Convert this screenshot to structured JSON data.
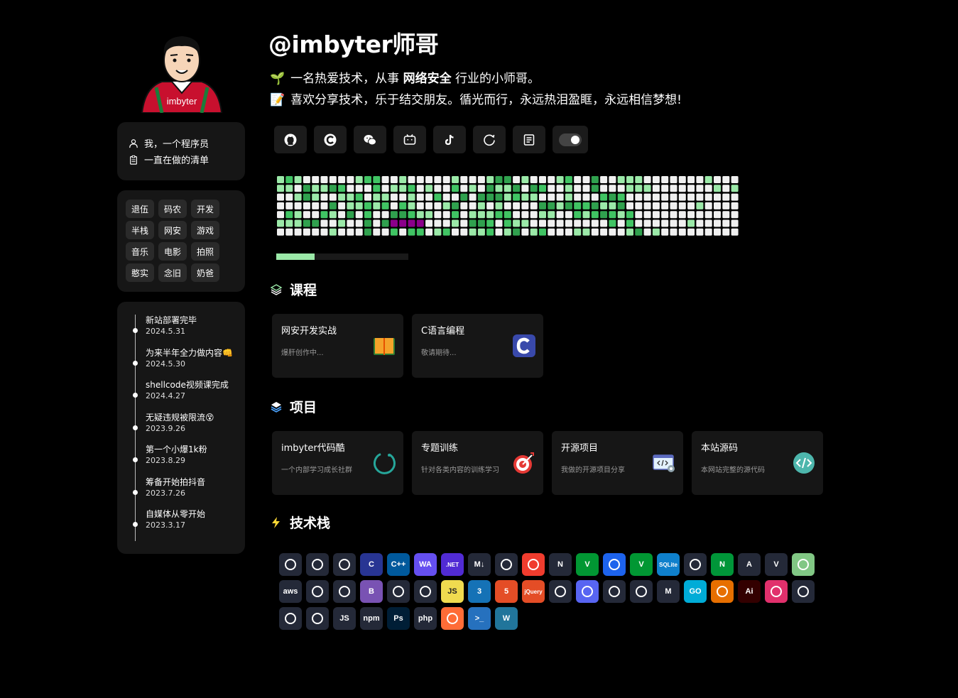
{
  "header": {
    "title": "@imbyter师哥",
    "bio_line1_prefix": "一名热爱技术，从事",
    "bio_line1_bold": "网络安全",
    "bio_line1_suffix": "行业的小师哥。",
    "bio_line2": "喜欢分享技术，乐于结交朋友。循光而行，永远热泪盈眶，永远相信梦想!"
  },
  "avatar": {
    "shirt_text": "imbyter"
  },
  "profile": {
    "items": [
      {
        "label": "我，一个程序员",
        "icon": "user-icon"
      },
      {
        "label": "一直在做的清单",
        "icon": "clipboard-icon"
      }
    ]
  },
  "tags": [
    "退伍",
    "码农",
    "开发",
    "半栈",
    "网安",
    "游戏",
    "音乐",
    "电影",
    "拍照",
    "憨实",
    "念旧",
    "奶爸"
  ],
  "timeline": [
    {
      "title": "新站部署完毕",
      "date": "2024.5.31"
    },
    {
      "title": "为来半年全力做内容👊",
      "date": "2024.5.30"
    },
    {
      "title": "shellcode视频课完成",
      "date": "2024.4.27"
    },
    {
      "title": "无疑违规被限流😵",
      "date": "2023.9.26"
    },
    {
      "title": "第一个小爆1k粉",
      "date": "2023.8.29"
    },
    {
      "title": "筹备开始拍抖音",
      "date": "2023.7.26"
    },
    {
      "title": "自媒体从零开始",
      "date": "2023.3.17"
    }
  ],
  "socials": [
    "github-icon",
    "csdn-icon",
    "wechat-icon",
    "bilibili-icon",
    "tiktok-icon",
    "refresh-icon",
    "blog-icon",
    "theme-toggle"
  ],
  "contributions": {
    "progress": 0.29
  },
  "courses": {
    "heading": "课程",
    "items": [
      {
        "title": "网安开发实战",
        "subtitle": "爆肝创作中...",
        "icon": "book-icon"
      },
      {
        "title": "C语言编程",
        "subtitle": "敬请期待...",
        "icon": "c-lang-icon"
      }
    ]
  },
  "projects": {
    "heading": "项目",
    "items": [
      {
        "title": "imbyter代码酷",
        "subtitle": "一个内部学习成长社群",
        "icon": "ring-icon"
      },
      {
        "title": "专题训练",
        "subtitle": "针对各类内容的训练学习",
        "icon": "target-icon"
      },
      {
        "title": "开源项目",
        "subtitle": "我做的开源项目分享",
        "icon": "code-window-icon"
      },
      {
        "title": "本站源码",
        "subtitle": "本网站完整的源代码",
        "icon": "code-circle-icon"
      }
    ]
  },
  "stack": {
    "heading": "技术栈",
    "items": [
      {
        "name": "windows",
        "text": "",
        "bg": "#242938"
      },
      {
        "name": "visual-studio",
        "text": "",
        "bg": "#242938"
      },
      {
        "name": "vscode",
        "text": "",
        "bg": "#242938"
      },
      {
        "name": "c",
        "text": "C",
        "bg": "#283593"
      },
      {
        "name": "cpp",
        "text": "C++",
        "bg": "#00599c"
      },
      {
        "name": "webassembly",
        "text": "WA",
        "bg": "#654ff0"
      },
      {
        "name": "dotnet",
        "text": ".NET",
        "bg": "#512bd4"
      },
      {
        "name": "markdown",
        "text": "M↓",
        "bg": "#242938"
      },
      {
        "name": "python",
        "text": "",
        "bg": "#242938"
      },
      {
        "name": "git",
        "text": "",
        "bg": "#f03c2e"
      },
      {
        "name": "notion",
        "text": "N",
        "bg": "#242938"
      },
      {
        "name": "vim",
        "text": "V",
        "bg": "#019733"
      },
      {
        "name": "docker",
        "text": "",
        "bg": "#1d63ed"
      },
      {
        "name": "vim2",
        "text": "V",
        "bg": "#019733"
      },
      {
        "name": "sqlite",
        "text": "SQLite",
        "bg": "#0f80cc"
      },
      {
        "name": "mysql",
        "text": "",
        "bg": "#242938"
      },
      {
        "name": "nginx",
        "text": "N",
        "bg": "#009639"
      },
      {
        "name": "angular",
        "text": "A",
        "bg": "#242938"
      },
      {
        "name": "vue",
        "text": "V",
        "bg": "#242938"
      },
      {
        "name": "react",
        "text": "",
        "bg": "#81c784"
      },
      {
        "name": "aws",
        "text": "aws",
        "bg": "#242938"
      },
      {
        "name": "vite",
        "text": "",
        "bg": "#242938"
      },
      {
        "name": "bun",
        "text": "",
        "bg": "#242938"
      },
      {
        "name": "bootstrap",
        "text": "B",
        "bg": "#7952b3"
      },
      {
        "name": "cloudflare",
        "text": "",
        "bg": "#242938"
      },
      {
        "name": "arch",
        "text": "",
        "bg": "#242938"
      },
      {
        "name": "javascript",
        "text": "JS",
        "bg": "#f0db4f"
      },
      {
        "name": "css3",
        "text": "3",
        "bg": "#1572b6"
      },
      {
        "name": "html5",
        "text": "5",
        "bg": "#e44d26"
      },
      {
        "name": "jquery",
        "text": "jQuery",
        "bg": "#e44d26"
      },
      {
        "name": "ubuntu",
        "text": "",
        "bg": "#242938"
      },
      {
        "name": "discord",
        "text": "",
        "bg": "#5865f2"
      },
      {
        "name": "eclipse",
        "text": "",
        "bg": "#242938"
      },
      {
        "name": "github",
        "text": "",
        "bg": "#242938"
      },
      {
        "name": "gmail",
        "text": "M",
        "bg": "#242938"
      },
      {
        "name": "go",
        "text": "GO",
        "bg": "#00acd7"
      },
      {
        "name": "java",
        "text": "",
        "bg": "#e76f00"
      },
      {
        "name": "illustrator",
        "text": "Ai",
        "bg": "#330000"
      },
      {
        "name": "instagram",
        "text": "",
        "bg": "#e1306c"
      },
      {
        "name": "box",
        "text": "",
        "bg": "#242938"
      },
      {
        "name": "laravel",
        "text": "",
        "bg": "#242938"
      },
      {
        "name": "linux",
        "text": "",
        "bg": "#242938"
      },
      {
        "name": "nodejs",
        "text": "JS",
        "bg": "#242938"
      },
      {
        "name": "npm",
        "text": "npm",
        "bg": "#242938"
      },
      {
        "name": "photoshop",
        "text": "Ps",
        "bg": "#001e36"
      },
      {
        "name": "php",
        "text": "php",
        "bg": "#242938"
      },
      {
        "name": "postman",
        "text": "",
        "bg": "#ff6c37"
      },
      {
        "name": "powershell",
        "text": ">_",
        "bg": "#2671be"
      },
      {
        "name": "wordpress",
        "text": "W",
        "bg": "#21759b"
      }
    ]
  }
}
